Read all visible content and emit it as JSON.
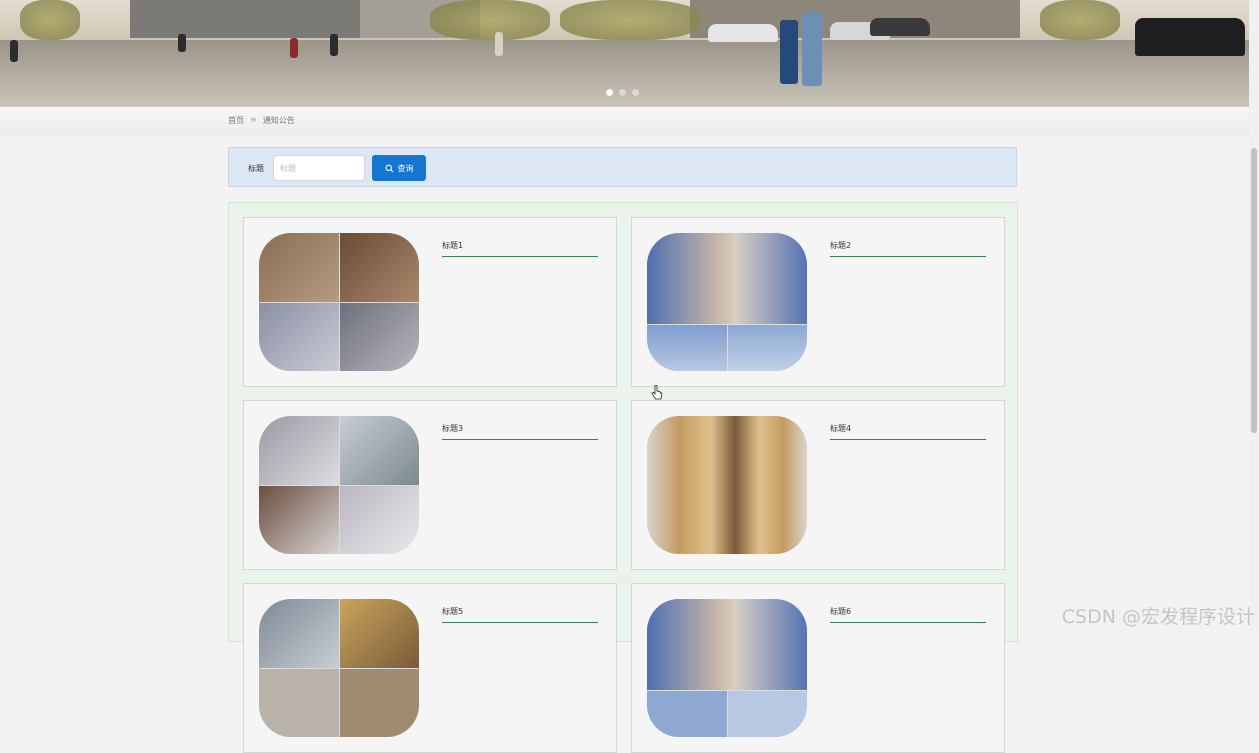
{
  "banner": {
    "slides": 3,
    "active_slide": 1
  },
  "breadcrumb": {
    "home": "首页",
    "separator": "≡",
    "current": "通知公告"
  },
  "search": {
    "label": "标题",
    "placeholder": "标题",
    "value": "",
    "button_label": "查询",
    "button_color": "#1576d1"
  },
  "cards": [
    {
      "title": "标题1"
    },
    {
      "title": "标题2"
    },
    {
      "title": "标题3"
    },
    {
      "title": "标题4"
    },
    {
      "title": "标题5"
    },
    {
      "title": "标题6"
    }
  ],
  "watermark": "CSDN @宏发程序设计",
  "colors": {
    "accent": "#1576d1",
    "title_underline": "#2e8b4f",
    "search_bg": "#dde7f3",
    "list_bg": "#e9f3ea"
  }
}
